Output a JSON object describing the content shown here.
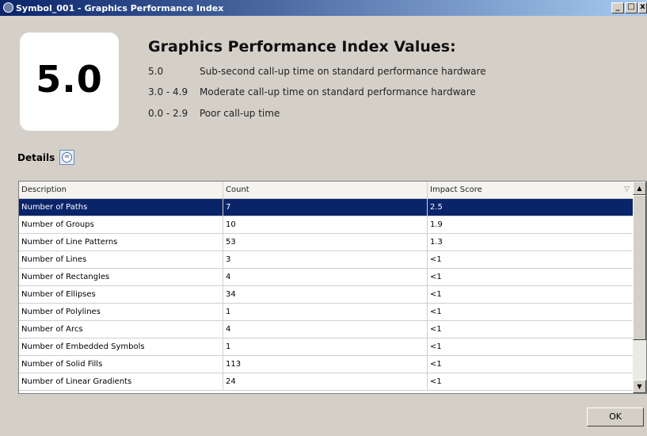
{
  "window": {
    "title": "Symbol_001 - Graphics Performance Index",
    "minimize_glyph": "_",
    "maximize_glyph": "□",
    "close_glyph": "x"
  },
  "score": "5.0",
  "index": {
    "heading": "Graphics Performance Index Values:",
    "ranges": [
      {
        "range": "5.0",
        "desc": "Sub-second call-up time on standard performance hardware"
      },
      {
        "range": "3.0 - 4.9",
        "desc": "Moderate call-up time on standard performance hardware"
      },
      {
        "range": "0.0 - 2.9",
        "desc": "Poor call-up time"
      }
    ]
  },
  "details": {
    "label": "Details",
    "toggle_glyph": "≈"
  },
  "table": {
    "columns": [
      "Description",
      "Count",
      "Impact Score"
    ],
    "sort_glyph": "▽",
    "rows": [
      {
        "description": "Number of Paths",
        "count": "7",
        "impact": "2.5"
      },
      {
        "description": "Number of Groups",
        "count": "10",
        "impact": "1.9"
      },
      {
        "description": "Number of Line Patterns",
        "count": "53",
        "impact": "1.3"
      },
      {
        "description": "Number of Lines",
        "count": "3",
        "impact": "<1"
      },
      {
        "description": "Number of Rectangles",
        "count": "4",
        "impact": "<1"
      },
      {
        "description": "Number of Ellipses",
        "count": "34",
        "impact": "<1"
      },
      {
        "description": "Number of Polylines",
        "count": "1",
        "impact": "<1"
      },
      {
        "description": "Number of Arcs",
        "count": "4",
        "impact": "<1"
      },
      {
        "description": "Number of Embedded Symbols",
        "count": "1",
        "impact": "<1"
      },
      {
        "description": "Number of Solid Fills",
        "count": "113",
        "impact": "<1"
      },
      {
        "description": "Number of Linear Gradients",
        "count": "24",
        "impact": "<1"
      }
    ],
    "selected_row": 0
  },
  "scrollbar": {
    "up_glyph": "▲",
    "down_glyph": "▼"
  },
  "ok_label": "OK"
}
